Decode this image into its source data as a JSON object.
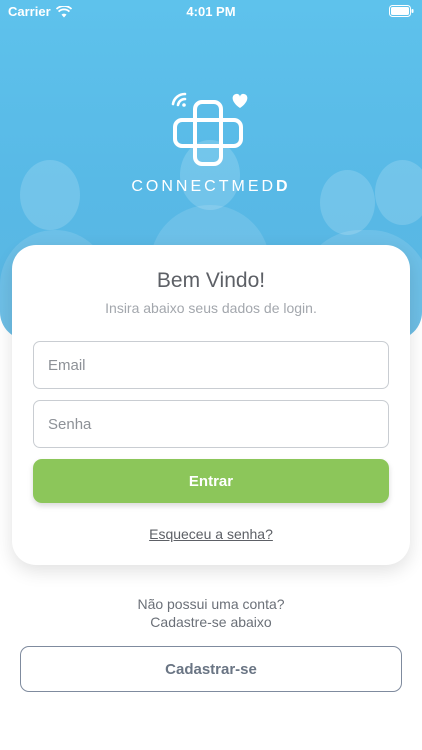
{
  "status_bar": {
    "carrier": "Carrier",
    "time": "4:01 PM",
    "wifi_icon": "wifi-icon",
    "battery_icon": "battery-icon"
  },
  "brand": {
    "name_light": "CONNECTMED",
    "name_bold": "D",
    "logo_icon": "medical-cross-heart-icon",
    "color": "#ffffff"
  },
  "login": {
    "title": "Bem Vindo!",
    "subtitle": "Insira abaixo seus dados de login.",
    "email_placeholder": "Email",
    "password_placeholder": "Senha",
    "submit_label": "Entrar",
    "forgot_label": "Esqueceu a senha?"
  },
  "signup": {
    "prompt_line1": "Não possui uma conta?",
    "prompt_line2": "Cadastre-se abaixo",
    "button_label": "Cadastrar-se"
  },
  "colors": {
    "hero_blue": "#5ec2ec",
    "primary_green": "#8cc65a",
    "text_gray": "#5d6066"
  }
}
